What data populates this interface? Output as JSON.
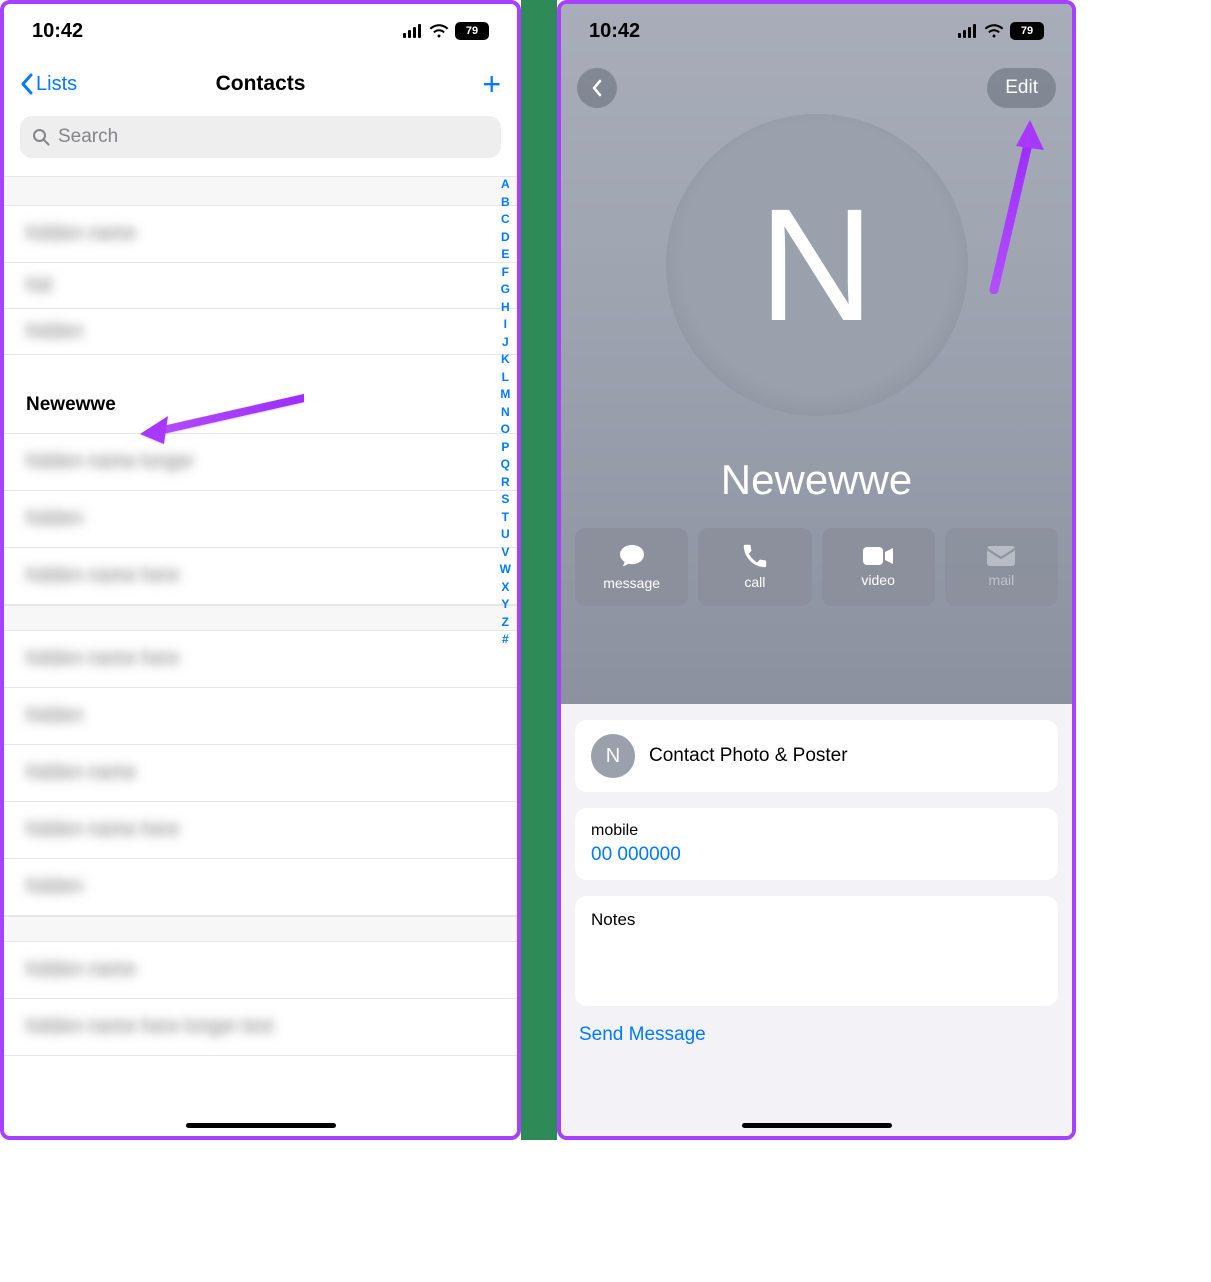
{
  "status": {
    "time": "10:42",
    "battery": "79"
  },
  "left": {
    "back_label": "Lists",
    "title": "Contacts",
    "search_placeholder": "Search",
    "visible_contact": "Newewwe",
    "alpha_index": [
      "A",
      "B",
      "C",
      "D",
      "E",
      "F",
      "G",
      "H",
      "I",
      "J",
      "K",
      "L",
      "M",
      "N",
      "O",
      "P",
      "Q",
      "R",
      "S",
      "T",
      "U",
      "V",
      "W",
      "X",
      "Y",
      "Z",
      "#"
    ],
    "blur_rows": [
      "hideplace",
      "hideplace",
      "hideplace",
      "hideplace",
      "hideplace",
      "hideplace",
      "hideplace",
      "hideplace",
      "hideplace",
      "hideplace",
      "hideplace",
      "hideplace",
      "hideplace"
    ]
  },
  "right": {
    "edit_label": "Edit",
    "avatar_initial": "N",
    "contact_name": "Newewwe",
    "actions": {
      "message": "message",
      "call": "call",
      "video": "video",
      "mail": "mail"
    },
    "photo_poster": {
      "initial": "N",
      "label": "Contact Photo & Poster"
    },
    "phone": {
      "label": "mobile",
      "number": "00 000000"
    },
    "notes_label": "Notes",
    "send_message": "Send Message"
  }
}
